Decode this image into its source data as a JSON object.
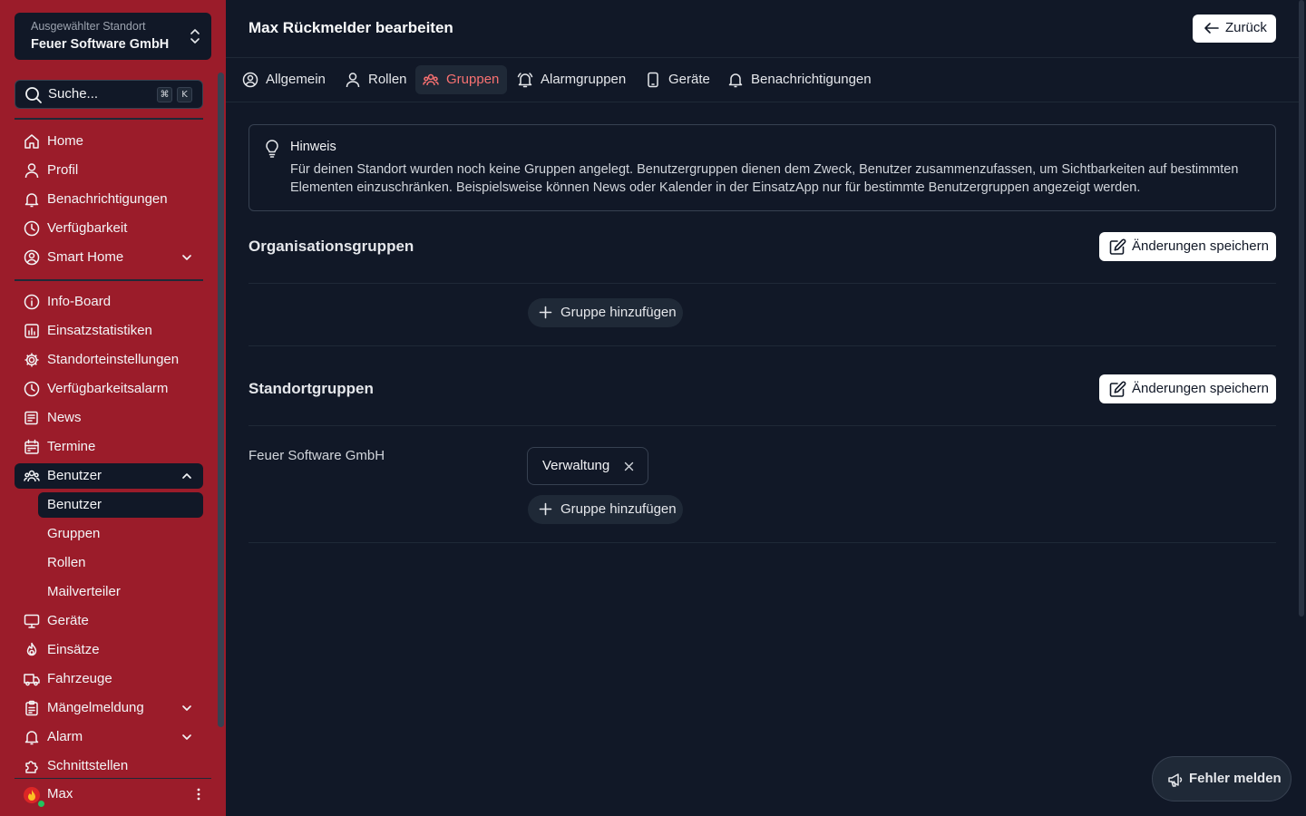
{
  "location": {
    "caption": "Ausgewählter Standort",
    "name": "Feuer Software GmbH"
  },
  "search": {
    "placeholder": "Suche...",
    "shortcut_mod": "⌘",
    "shortcut_key": "K"
  },
  "nav": {
    "home": "Home",
    "profil": "Profil",
    "benachrichtigungen": "Benachrichtigungen",
    "verfuegbarkeit": "Verfügbarkeit",
    "smarthome": "Smart Home",
    "infoboard": "Info-Board",
    "einsatzstatistiken": "Einsatzstatistiken",
    "standorteinstellungen": "Standorteinstellungen",
    "verfuegbarkeitsalarm": "Verfügbarkeitsalarm",
    "news": "News",
    "termine": "Termine",
    "benutzer": "Benutzer",
    "sub_benutzer": "Benutzer",
    "sub_gruppen": "Gruppen",
    "sub_rollen": "Rollen",
    "sub_mailverteiler": "Mailverteiler",
    "geraete": "Geräte",
    "einsaetze": "Einsätze",
    "fahrzeuge": "Fahrzeuge",
    "maengelmeldung": "Mängelmeldung",
    "alarm": "Alarm",
    "schnittstellen": "Schnittstellen"
  },
  "user": {
    "name": "Max"
  },
  "header": {
    "title": "Max Rückmelder bearbeiten",
    "back_label": "Zurück"
  },
  "tabs": {
    "allgemein": "Allgemein",
    "rollen": "Rollen",
    "gruppen": "Gruppen",
    "alarmgruppen": "Alarmgruppen",
    "geraete": "Geräte",
    "benachrichtigungen": "Benachrichtigungen"
  },
  "hint": {
    "title": "Hinweis",
    "text": "Für deinen Standort wurden noch keine Gruppen angelegt. Benutzergruppen dienen dem Zweck, Benutzer zusammenzufassen, um Sichtbarkeiten auf bestimmten Elementen einzuschränken. Beispielsweise können News oder Kalender in der EinsatzApp nur für bestimmte Benutzergruppen angezeigt werden."
  },
  "org_groups": {
    "title": "Organisationsgruppen",
    "save_label": "Änderungen speichern",
    "add_label": "Gruppe hinzufügen"
  },
  "site_groups": {
    "title": "Standortgruppen",
    "save_label": "Änderungen speichern",
    "add_label": "Gruppe hinzufügen",
    "site_name": "Feuer Software GmbH",
    "chips": [
      "Verwaltung"
    ]
  },
  "report": {
    "label": "Fehler melden"
  },
  "colors": {
    "sidebar": "#9b1c2a",
    "background": "#111827",
    "accent": "#f87171"
  }
}
